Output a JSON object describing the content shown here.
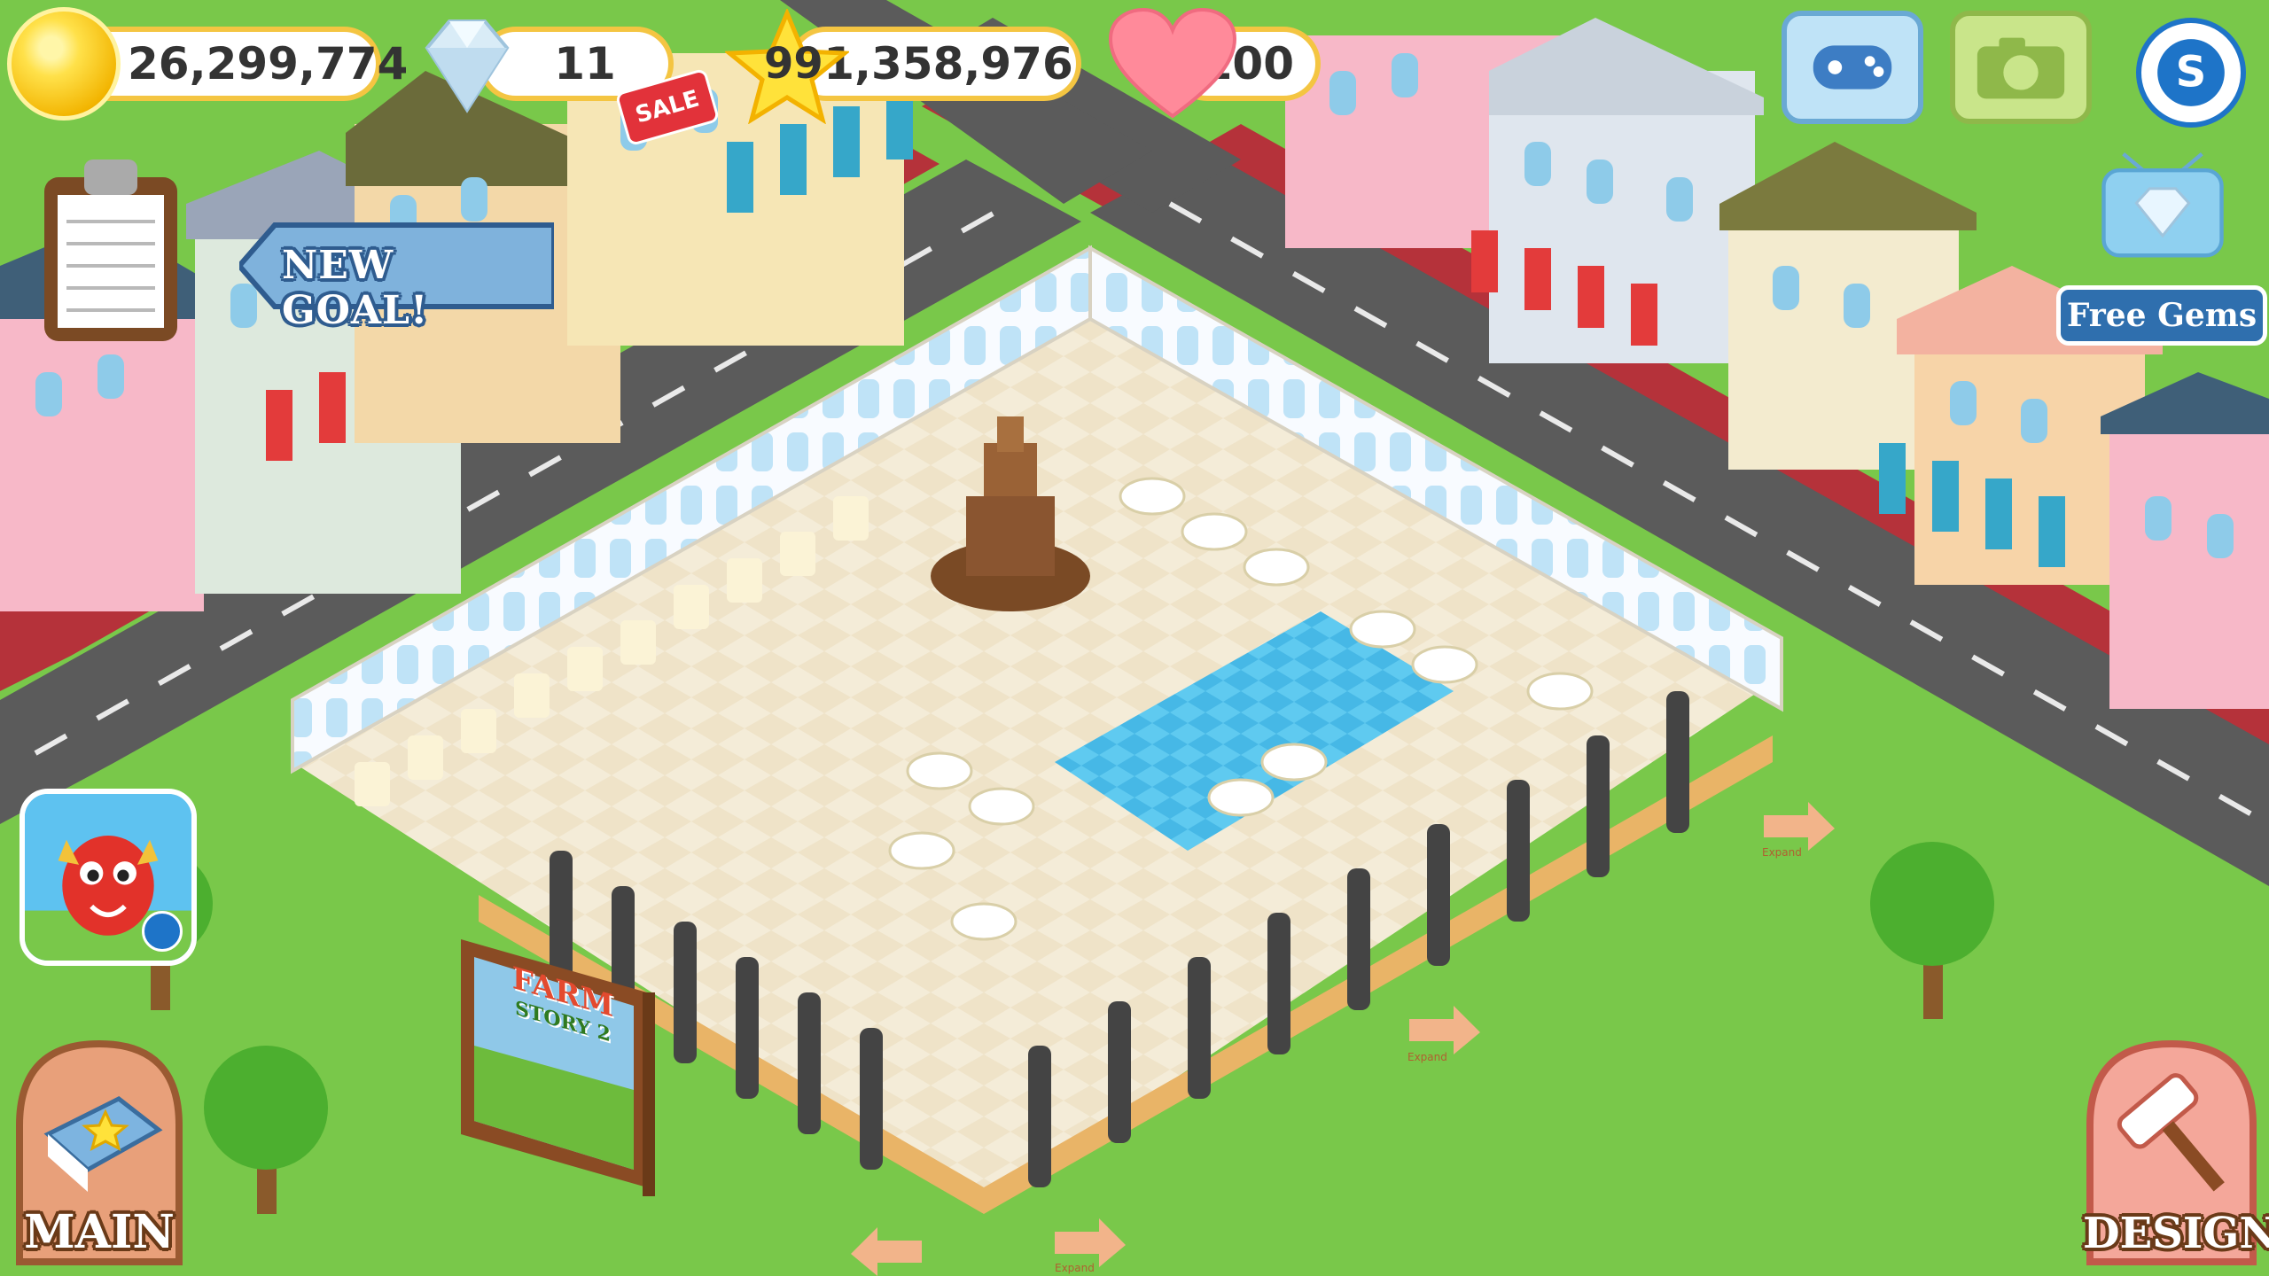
{
  "hud": {
    "coins": "26,299,774",
    "gems": "11",
    "sale_badge": "SALE",
    "level": "99",
    "experience": "1,358,976",
    "hearts": "100"
  },
  "top_right": {
    "gamepad_icon": "gamepad-icon",
    "camera_icon": "camera-icon",
    "s_icon": "s-currency-icon"
  },
  "goals": {
    "new_goal_label": "NEW GOAL!"
  },
  "free_gems": {
    "label": "Free Gems"
  },
  "billboard": {
    "title": "FARM",
    "subtitle": "STORY 2"
  },
  "expand": {
    "label": "Expand"
  },
  "bottom": {
    "main_label": "MAIN",
    "design_label": "DESIGN"
  },
  "colors": {
    "grass": "#79c84a",
    "road": "#5a5a5a",
    "sidewalk": "#b5323a",
    "hud_border": "#f4c542",
    "accent_blue": "#2f5c8f"
  }
}
